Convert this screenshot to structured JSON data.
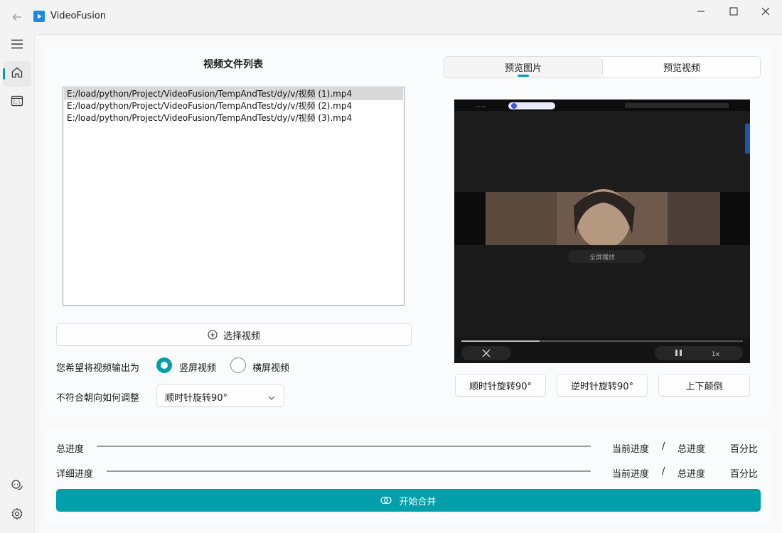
{
  "window": {
    "title": "VideoFusion"
  },
  "file_list": {
    "title": "视频文件列表",
    "items": [
      "E:/load/python/Project/VideoFusion/TempAndTest/dy/v/视频  (1).mp4",
      "E:/load/python/Project/VideoFusion/TempAndTest/dy/v/视频  (2).mp4",
      "E:/load/python/Project/VideoFusion/TempAndTest/dy/v/视频  (3).mp4"
    ]
  },
  "select_video_button": "选择视频",
  "orientation": {
    "label": "您希望将视频输出为",
    "options": [
      "竖屏视频",
      "横屏视频"
    ],
    "selected": "竖屏视频"
  },
  "adjust": {
    "label": "不符合朝向如何调整",
    "selected": "顺时针旋转90°"
  },
  "preview_tabs": {
    "items": [
      "预览图片",
      "预览视频"
    ],
    "selected": "预览图片"
  },
  "preview_overlay": {
    "caption": "全屏播放",
    "speed": "1x"
  },
  "rotate_buttons": [
    "顺时针旋转90°",
    "逆时针旋转90°",
    "上下颠倒"
  ],
  "progress": {
    "total_label": "总进度",
    "detail_label": "详细进度",
    "current_label": "当前进度",
    "separator": "/",
    "overall_label": "总进度",
    "percent_label": "百分比",
    "total_value": 0,
    "detail_value": 0
  },
  "merge_button": "开始合并",
  "colors": {
    "accent": "#009faa"
  }
}
